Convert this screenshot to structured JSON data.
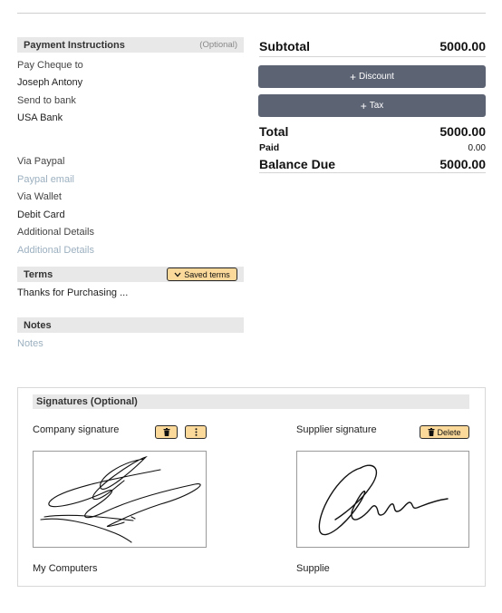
{
  "payment": {
    "title": "Payment Instructions",
    "optional": "(Optional)",
    "pay_cheque_label": "Pay Cheque to",
    "pay_cheque_value": "Joseph Antony",
    "send_bank_label": "Send to bank",
    "send_bank_value": "USA Bank",
    "paypal_label": "Via Paypal",
    "paypal_placeholder": "Paypal email",
    "wallet_label": "Via Wallet",
    "wallet_value": "Debit Card",
    "additional_label": "Additional Details",
    "additional_placeholder": "Additional Details"
  },
  "terms": {
    "title": "Terms",
    "saved_terms_label": "Saved terms",
    "value": "Thanks for Purchasing ..."
  },
  "notes": {
    "title": "Notes",
    "placeholder": "Notes"
  },
  "summary": {
    "subtotal_label": "Subtotal",
    "subtotal_value": "5000.00",
    "discount_label": "Discount",
    "tax_label": "Tax",
    "total_label": "Total",
    "total_value": "5000.00",
    "paid_label": "Paid",
    "paid_value": "0.00",
    "balance_label": "Balance Due",
    "balance_value": "5000.00"
  },
  "signatures": {
    "title": "Signatures (Optional)",
    "company_label": "Company signature",
    "company_name": "My Computers",
    "supplier_label": "Supplier signature",
    "supplier_name": "Supplie",
    "delete_label": "Delete"
  },
  "icons": {
    "trash": "trash-icon",
    "more": "more-vertical-icon",
    "chevron": "chevron-down-icon",
    "plus": "plus-icon"
  },
  "colors": {
    "button_gray": "#5c6373",
    "button_yellow": "#fbd99a",
    "section_header": "#e8e8e8",
    "placeholder": "#9cb0c0"
  }
}
